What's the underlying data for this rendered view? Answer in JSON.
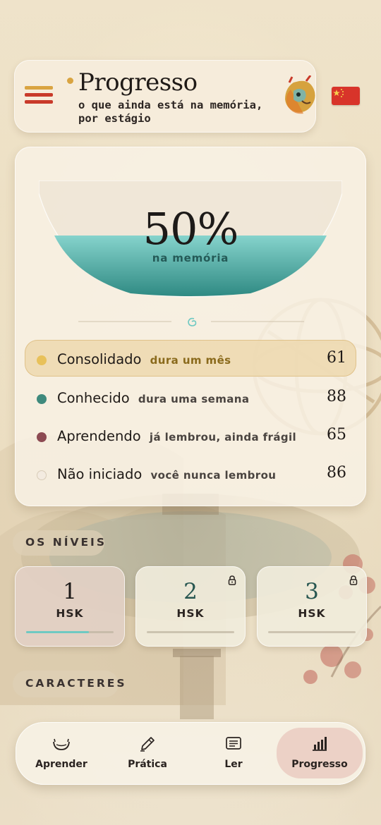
{
  "header": {
    "title": "Progresso",
    "subtitle": "o que ainda está na memória, por estágio"
  },
  "summary": {
    "percent": "50%",
    "percent_label": "na memória",
    "fill_fraction": 0.5
  },
  "stages": [
    {
      "label": "Consolidado",
      "desc": "dura um mês",
      "count": "61",
      "color": "#e8c15a",
      "desc_color": "#8a6a1c",
      "active": true
    },
    {
      "label": "Conhecido",
      "desc": "dura uma semana",
      "count": "88",
      "color": "#3f8a7d",
      "desc_color": "#4a4440",
      "active": false
    },
    {
      "label": "Aprendendo",
      "desc": "já lembrou, ainda frágil",
      "count": "65",
      "color": "#8c4a52",
      "desc_color": "#4a4440",
      "active": false
    },
    {
      "label": "Não iniciado",
      "desc": "você nunca lembrou",
      "count": "86",
      "color": "#f3ebe0",
      "desc_color": "#4a4440",
      "active": false
    }
  ],
  "levels_section": {
    "title": "OS NÍVEIS"
  },
  "levels": [
    {
      "number": "1",
      "name": "HSK",
      "locked": false,
      "selected": true,
      "progress": 0.72
    },
    {
      "number": "2",
      "name": "HSK",
      "locked": true,
      "selected": false,
      "progress": 0
    },
    {
      "number": "3",
      "name": "HSK",
      "locked": true,
      "selected": false,
      "progress": 0
    }
  ],
  "characters_section": {
    "title": "CARACTERES"
  },
  "nav": {
    "items": [
      {
        "label": "Aprender",
        "icon": "bowl-icon",
        "active": false
      },
      {
        "label": "Prática",
        "icon": "brush-icon",
        "active": false
      },
      {
        "label": "Ler",
        "icon": "book-icon",
        "active": false
      },
      {
        "label": "Progresso",
        "icon": "bar-chart-icon",
        "active": true
      }
    ]
  },
  "colors": {
    "accent_red": "#c93a2a",
    "accent_gold": "#d9a441",
    "teal": "#6fc9c2",
    "active_nav": "#ecd1c6"
  }
}
